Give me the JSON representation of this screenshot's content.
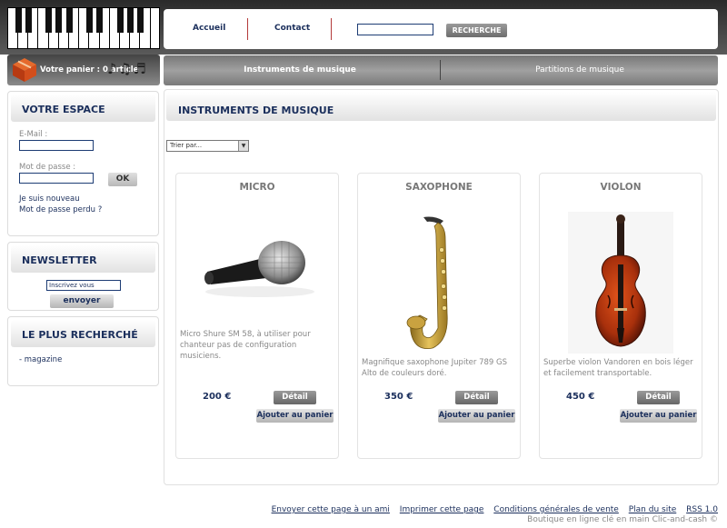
{
  "header": {
    "nav": [
      "Accueil",
      "Contact"
    ],
    "search_button": "RECHERCHE"
  },
  "cart": {
    "label": "Votre panier : 0 article"
  },
  "categories": [
    "Instruments de musique",
    "Partitions de musique"
  ],
  "account": {
    "title": "VOTRE ESPACE",
    "email_label": "E-Mail :",
    "password_label": "Mot de passe :",
    "ok_label": "OK",
    "new_user": "Je suis nouveau",
    "lost_password": "Mot de passe perdu ?"
  },
  "newsletter": {
    "title": "NEWSLETTER",
    "input_value": "Inscrivez vous",
    "button": "envoyer"
  },
  "popular": {
    "title": "LE PLUS RECHERCHÉ",
    "items": [
      "- magazine"
    ]
  },
  "main": {
    "title": "INSTRUMENTS DE MUSIQUE",
    "sort_label": "Trier par..."
  },
  "products": [
    {
      "name": "MICRO",
      "description": "Micro Shure SM 58, à utiliser pour chanteur pas de configuration musiciens.",
      "price": "200 €",
      "detail": "Détail",
      "add": "Ajouter au panier"
    },
    {
      "name": "SAXOPHONE",
      "description": "Magnifique saxophone Jupiter 789 GS Alto de couleurs doré.",
      "price": "350 €",
      "detail": "Détail",
      "add": "Ajouter au panier"
    },
    {
      "name": "VIOLON",
      "description": "Superbe violon Vandoren en bois léger et facilement transportable.",
      "price": "450 €",
      "detail": "Détail",
      "add": "Ajouter au panier"
    }
  ],
  "footer": {
    "links": [
      "Envoyer cette page à un ami",
      "Imprimer cette page",
      "Conditions générales de vente",
      "Plan du site",
      "RSS 1.0"
    ],
    "copyright": "Boutique en ligne clé en main Clic-and-cash ©"
  },
  "colors": {
    "accent": "#1b2f5c",
    "separator": "#b33a3a"
  }
}
